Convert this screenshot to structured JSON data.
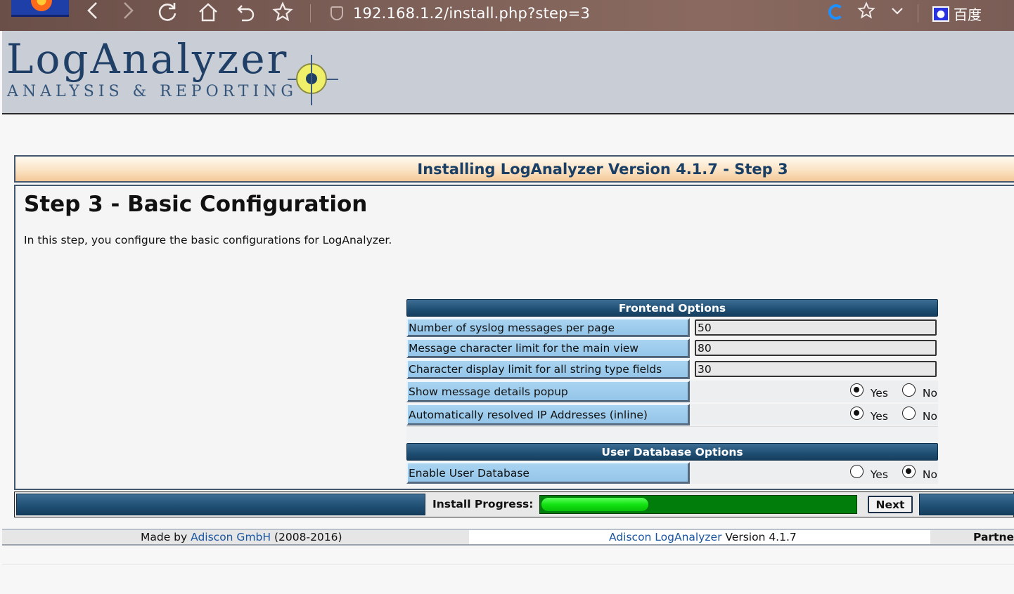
{
  "browser": {
    "url": "192.168.1.2/install.php?step=3",
    "baidu_label": "百度",
    "icons": [
      "back-icon",
      "forward-icon",
      "refresh-icon",
      "home-icon",
      "undo-icon",
      "star-icon",
      "shield-icon",
      "ie-icon",
      "favorite-icon",
      "chevron-down-icon",
      "baidu-paw-icon"
    ]
  },
  "logo": {
    "title": "LogAnalyzer",
    "subtitle": "ANALYSIS & REPORTING"
  },
  "installer": {
    "title": "Installing LogAnalyzer Version 4.1.7 - Step 3",
    "heading": "Step 3 - Basic Configuration",
    "description": "In this step, you configure the basic configurations for LogAnalyzer."
  },
  "frontend": {
    "header": "Frontend Options",
    "rows": [
      {
        "label": "Number of syslog messages per page",
        "value": "50"
      },
      {
        "label": "Message character limit for the main view",
        "value": "80"
      },
      {
        "label": "Character display limit for all string type fields",
        "value": "30"
      }
    ],
    "radios": [
      {
        "label": "Show message details popup",
        "selected": "Yes"
      },
      {
        "label": "Automatically resolved IP Addresses (inline)",
        "selected": "Yes"
      }
    ]
  },
  "userdb": {
    "header": "User Database Options",
    "radios": [
      {
        "label": "Enable User Database",
        "selected": "No"
      }
    ]
  },
  "options": {
    "yes": "Yes",
    "no": "No"
  },
  "progress": {
    "label": "Install Progress:",
    "fraction": 0.34,
    "next_label": "Next"
  },
  "footer": {
    "made_by": "Made by",
    "company": "Adiscon GmbH",
    "years": "(2008-2016)",
    "product": "Adiscon LogAnalyzer",
    "version": "Version 4.1.7",
    "partner": "Partner"
  },
  "colors": {
    "header_blue": "#1f4e73",
    "label_blue": "#a9d4f1",
    "title_text": "#1a3f66",
    "progress_green": "#007d0a",
    "progress_fill": "#12e312",
    "link": "#1a55a0"
  }
}
